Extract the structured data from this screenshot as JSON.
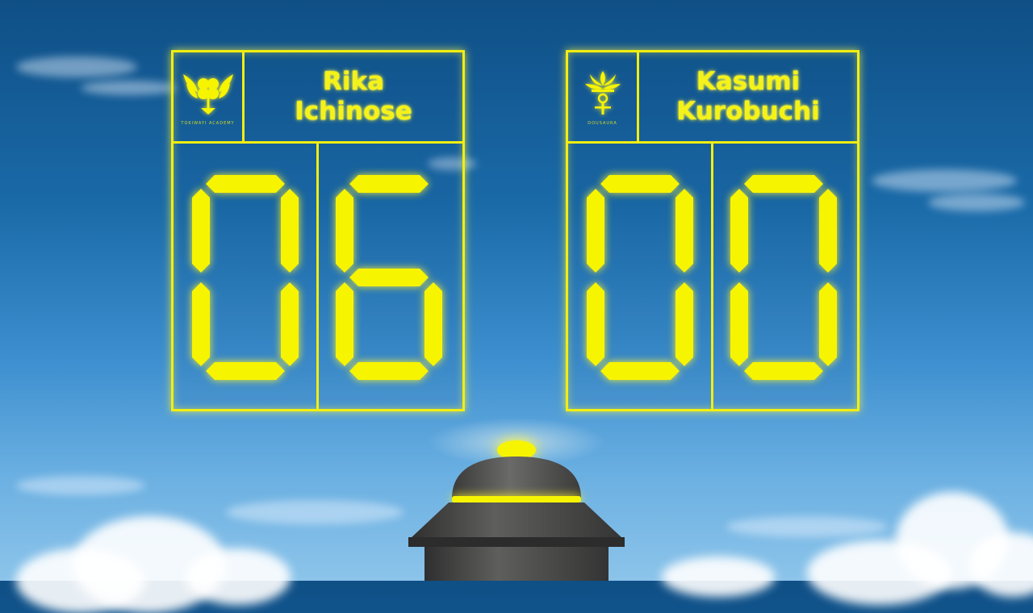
{
  "scoreboard": {
    "left": {
      "player_name_line1": "Rika",
      "player_name_line2": "Ichinose",
      "emblem_caption": "TOKIWAYI ACADEMY",
      "emblem_icon": "winged-clover-crest-icon",
      "score": "06",
      "digits": [
        "0",
        "6"
      ]
    },
    "right": {
      "player_name_line1": "Kasumi",
      "player_name_line2": "Kurobuchi",
      "emblem_caption": "DOUSAURA",
      "emblem_icon": "lily-sword-crest-icon",
      "score": "00",
      "digits": [
        "0",
        "0"
      ]
    }
  },
  "colors": {
    "display_yellow": "#f2ee10",
    "sky_top": "#0f4f86",
    "sky_bottom": "#8cc4ea"
  }
}
